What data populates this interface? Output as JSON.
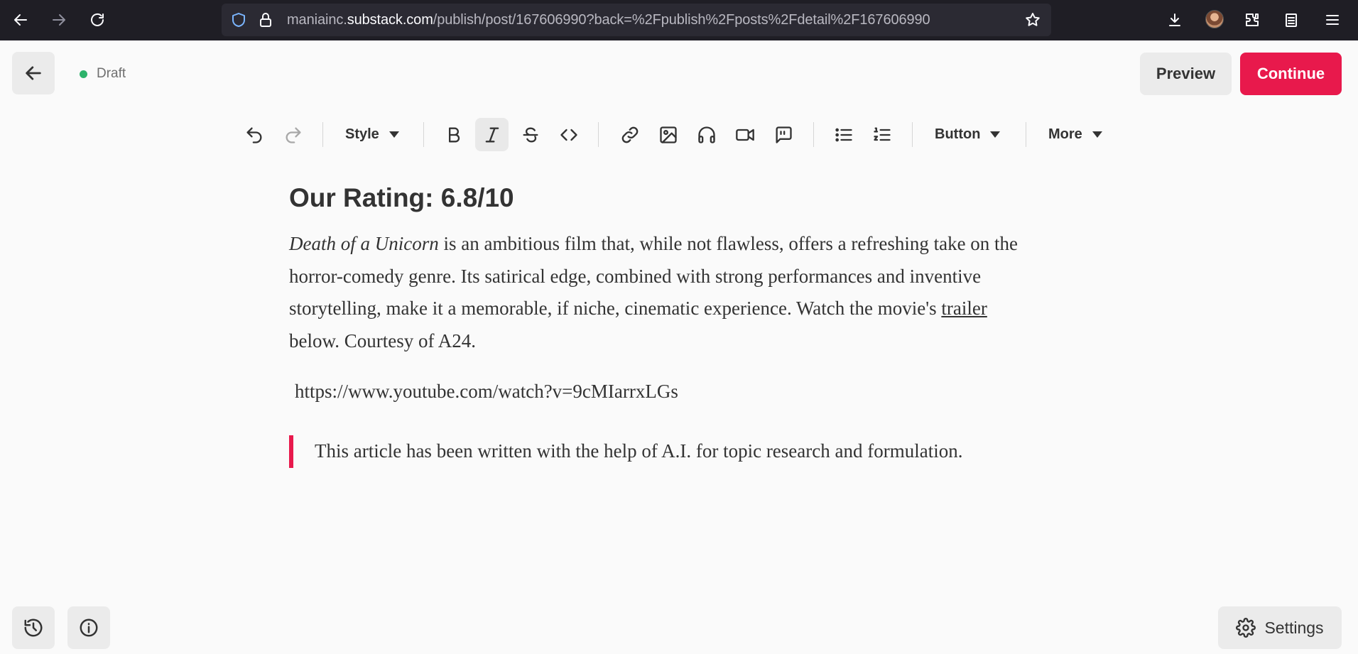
{
  "browser": {
    "url_prefix": "maniainc.",
    "url_host": "substack.com",
    "url_path": "/publish/post/167606990?back=%2Fpublish%2Fposts%2Fdetail%2F167606990"
  },
  "header": {
    "status": "Draft",
    "status_color": "#2db36b",
    "preview_label": "Preview",
    "continue_label": "Continue",
    "accent": "#e8194c"
  },
  "toolbar": {
    "style_label": "Style",
    "button_label": "Button",
    "more_label": "More"
  },
  "content": {
    "heading": "Our Rating: 6.8/10",
    "para_title": "Death of a Unicorn",
    "para_rest": " is an ambitious film that, while not flawless, offers a refreshing take on the horror-comedy genre. Its satirical edge, combined with strong performances and inventive storytelling, make it a memorable, if niche, cinematic experience. Watch the movie's ",
    "para_link": "trailer",
    "para_end": " below. Courtesy of A24.",
    "youtube_url": "https://www.youtube.com/watch?v=9cMIarrxLGs",
    "quote": "This article has been written with the help of A.I. for topic research and formulation."
  },
  "footer": {
    "settings_label": "Settings"
  }
}
